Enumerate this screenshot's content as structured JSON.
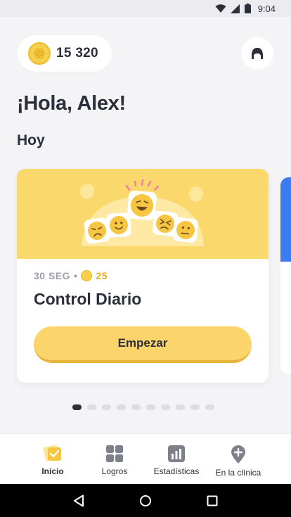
{
  "status_bar": {
    "time": "9:04",
    "icons": [
      "wifi-icon",
      "signal-icon",
      "battery-icon"
    ]
  },
  "header": {
    "coin_count": "15 320",
    "coin_icon": "coin-icon",
    "profile_icon": "avatar-icon"
  },
  "greeting": "¡Hola, Alex!",
  "section_title": "Hoy",
  "card": {
    "duration": "30 SEG",
    "separator": "•",
    "reward": "25",
    "title": "Control Diario",
    "button_label": "Empezar"
  },
  "pagination": {
    "total": 10,
    "active_index": 0
  },
  "bottom_nav": {
    "items": [
      {
        "label": "Inicio",
        "icon": "home-check-icon",
        "active": true
      },
      {
        "label": "Logros",
        "icon": "grid-icon",
        "active": false
      },
      {
        "label": "Estadísticas",
        "icon": "bar-chart-icon",
        "active": false
      },
      {
        "label": "En la clínica",
        "icon": "location-plus-icon",
        "active": false
      }
    ]
  },
  "system_nav": {
    "icons": [
      "back-icon",
      "home-icon",
      "recents-icon"
    ]
  },
  "colors": {
    "accent_yellow": "#fad86b",
    "button_yellow": "#fbd46b",
    "text_dark": "#2b2f3a",
    "secondary_blue": "#3d7cf0"
  }
}
